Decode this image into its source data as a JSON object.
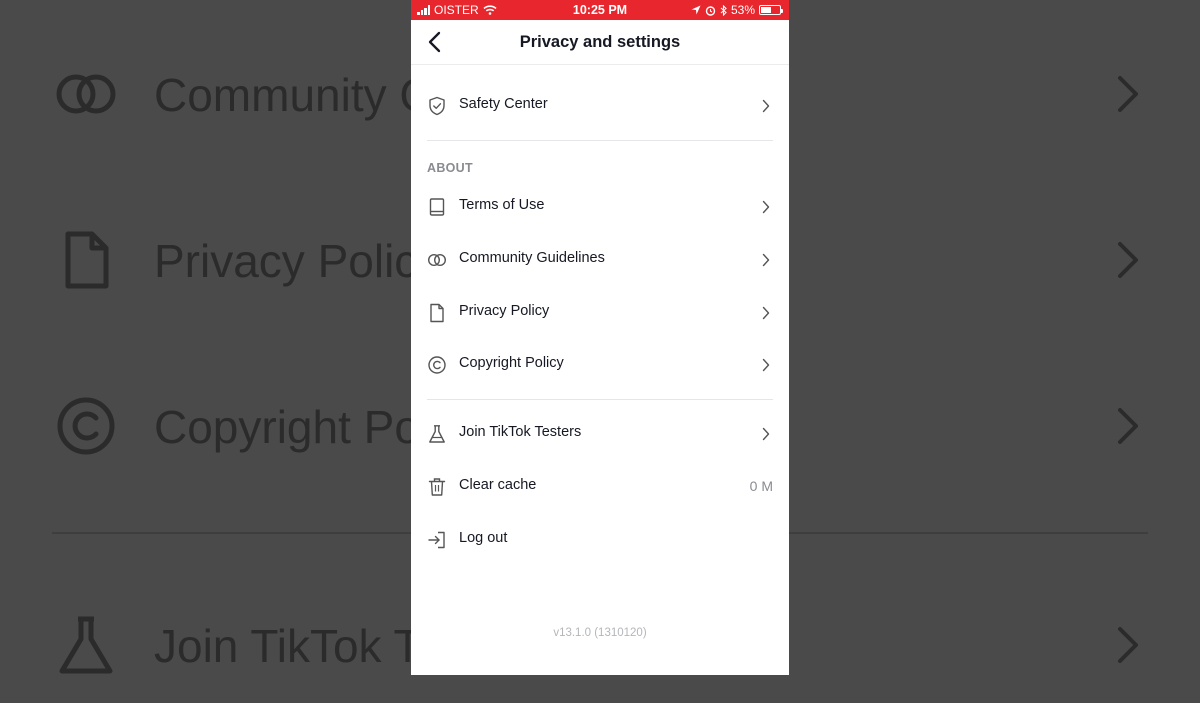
{
  "status_bar": {
    "carrier": "OISTER",
    "time": "10:25 PM",
    "battery_percent": "53%",
    "battery_level": 0.53,
    "background_color": "#e8262d"
  },
  "header": {
    "title": "Privacy and settings",
    "back_icon": "chevron-left-icon"
  },
  "rows": {
    "safety_center": {
      "label": "Safety Center",
      "icon": "shield-check-icon"
    },
    "terms_of_use": {
      "label": "Terms of Use",
      "icon": "book-icon"
    },
    "community_guidelines": {
      "label": "Community Guidelines",
      "icon": "rings-icon"
    },
    "privacy_policy": {
      "label": "Privacy Policy",
      "icon": "document-icon"
    },
    "copyright_policy": {
      "label": "Copyright Policy",
      "icon": "copyright-icon"
    },
    "join_testers": {
      "label": "Join TikTok Testers",
      "icon": "flask-icon"
    },
    "clear_cache": {
      "label": "Clear cache",
      "value": "0 M",
      "icon": "trash-icon"
    },
    "log_out": {
      "label": "Log out",
      "icon": "logout-icon"
    }
  },
  "sections": {
    "about": "ABOUT"
  },
  "version": "v13.1.0 (1310120)",
  "background": {
    "community": "Community G",
    "privacy": "Privacy Polic",
    "copyright": "Copyright Po",
    "join": "Join TikTok T"
  },
  "colors": {
    "text": "#161823",
    "secondary": "#8a8b91",
    "accent_red": "#e8262d"
  }
}
